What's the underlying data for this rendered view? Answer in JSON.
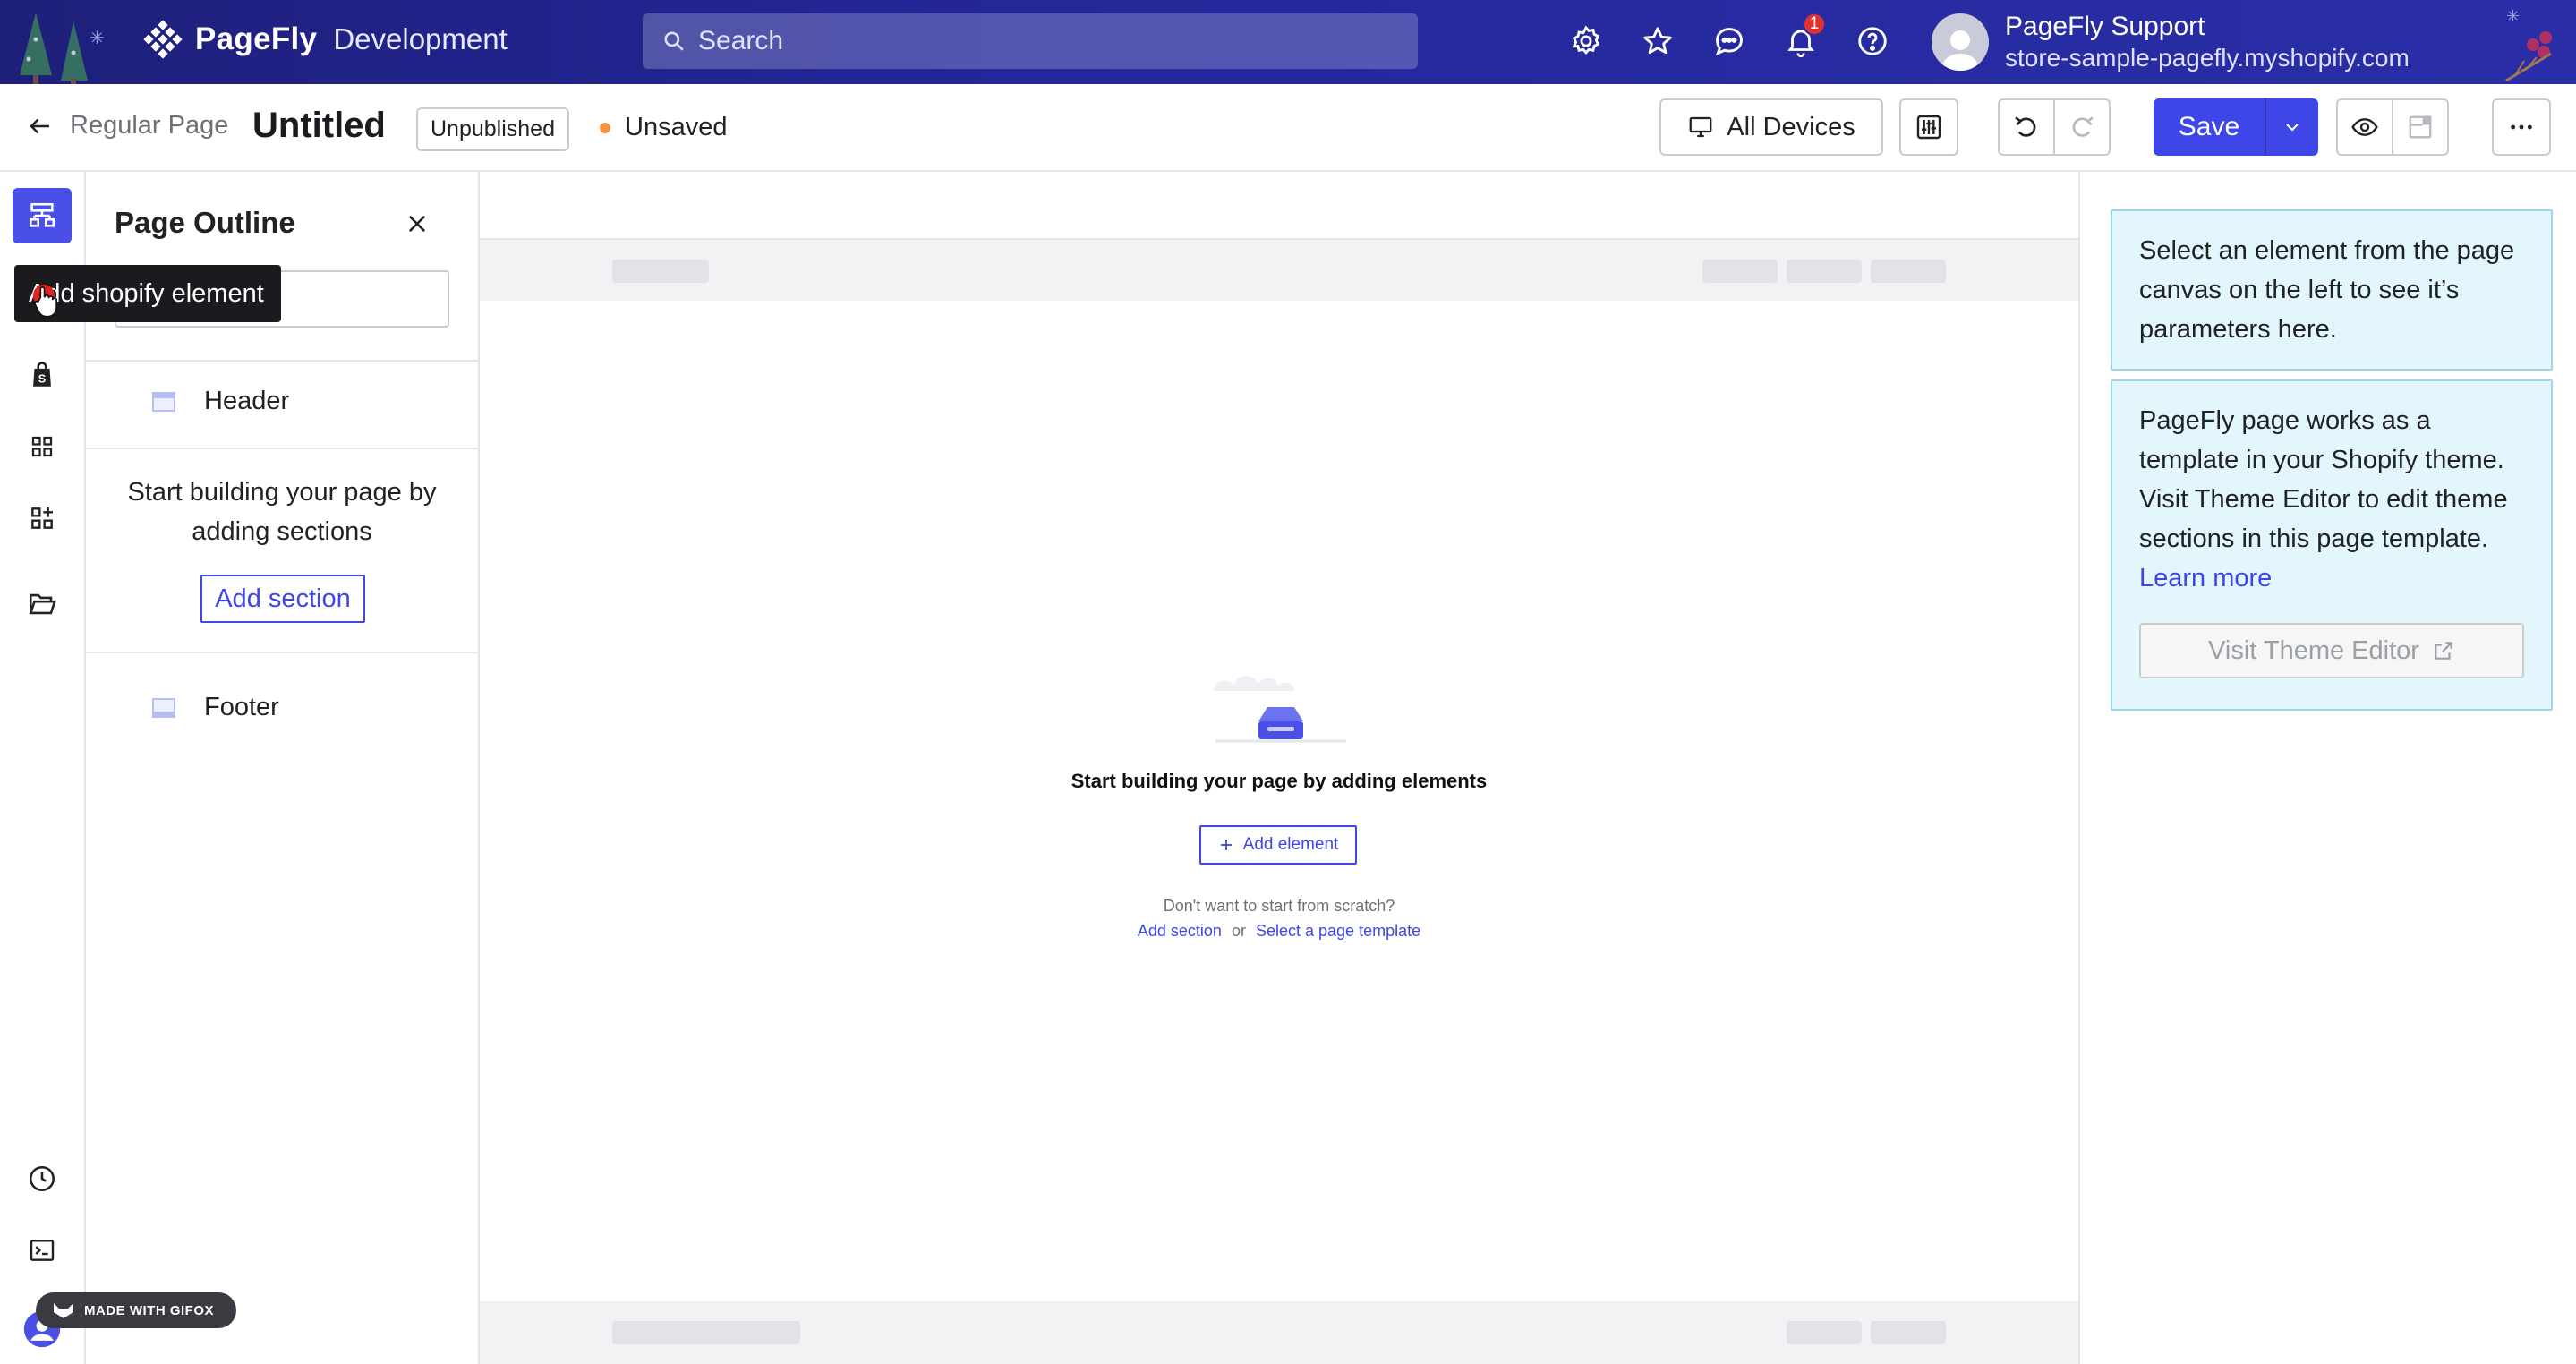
{
  "topbar": {
    "brand_name": "PageFly",
    "brand_env": "Development",
    "search_placeholder": "Search",
    "icons": [
      "settings-icon",
      "star-icon",
      "chat-icon",
      "bell-icon",
      "help-icon"
    ],
    "notification_count": "1",
    "user_name": "PageFly Support",
    "user_store": "store-sample-pagefly.myshopify.com"
  },
  "toolbar": {
    "back_label": "Regular Page",
    "page_title": "Untitled",
    "publish_status": "Unpublished",
    "save_status": "Unsaved",
    "devices_label": "All Devices",
    "save_label": "Save"
  },
  "rail": {
    "tooltip": "Add shopify element",
    "items": [
      "page-outline-icon",
      "shopify-icon",
      "grid-icon",
      "apps-icon",
      "folder-icon",
      "history-icon",
      "terminal-icon"
    ]
  },
  "outline": {
    "title": "Page Outline",
    "header_label": "Header",
    "empty_text_1": "Start building your page by",
    "empty_text_2": "adding sections",
    "add_section_label": "Add section",
    "footer_label": "Footer"
  },
  "canvas": {
    "empty_title": "Start building your page by adding elements",
    "add_element_label": "Add element",
    "scratch_text": "Don't want to start from scratch?",
    "add_section_link": "Add section",
    "or_text": "or",
    "template_link": "Select a page template"
  },
  "rpanel": {
    "select_hint": "Select an element from the page canvas on the left to see it’s parameters here.",
    "theme_info": "PageFly page works as a template in your Shopify theme. Visit Theme Editor to edit theme sections in this page template.",
    "learn_more": "Learn more",
    "visit_theme_editor": "Visit Theme Editor"
  },
  "watermark": "MADE WITH GIFOX",
  "colors": {
    "accent": "#3f46e8",
    "topbar": "#24279a",
    "info_bg": "#e3f6fb",
    "unsaved_dot": "#f49342",
    "badge": "#e0312f"
  }
}
